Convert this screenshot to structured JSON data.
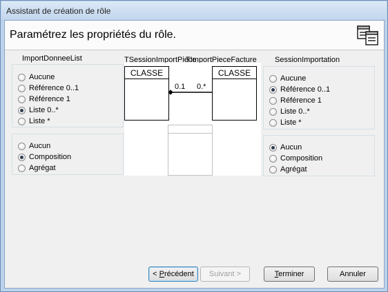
{
  "window": {
    "title": "Assistant de création de rôle"
  },
  "header": {
    "title": "Paramétrez les propriétés du rôle.",
    "icon": "wizard-icon"
  },
  "left": {
    "caption": "ImportDonneeList",
    "multiplicity": [
      "Aucune",
      "Référence 0..1",
      "Référence 1",
      "Liste 0..*",
      "Liste *"
    ],
    "multiplicity_selected": "Liste 0..*",
    "aggregation": [
      "Aucun",
      "Composition",
      "Agrégat"
    ],
    "aggregation_selected": "Composition"
  },
  "right": {
    "caption": "SessionImportation",
    "multiplicity": [
      "Aucune",
      "Référence 0..1",
      "Référence 1",
      "Liste 0..*",
      "Liste *"
    ],
    "multiplicity_selected": "Référence 0..1",
    "aggregation": [
      "Aucun",
      "Composition",
      "Agrégat"
    ],
    "aggregation_selected": "Aucun"
  },
  "diagram": {
    "left_class_caption": "TSessionImportPiece",
    "right_class_caption": "TImportPieceFacture",
    "left_box_label": "CLASSE",
    "right_box_label": "CLASSE",
    "left_multiplicity": "0.1",
    "right_multiplicity": "0.*"
  },
  "buttons": {
    "previous": {
      "prefix": "< ",
      "accel": "P",
      "rest": "récédent"
    },
    "next": {
      "label": "Suivant >"
    },
    "finish": {
      "accel": "T",
      "rest": "erminer"
    },
    "cancel": {
      "label": "Annuler"
    }
  }
}
